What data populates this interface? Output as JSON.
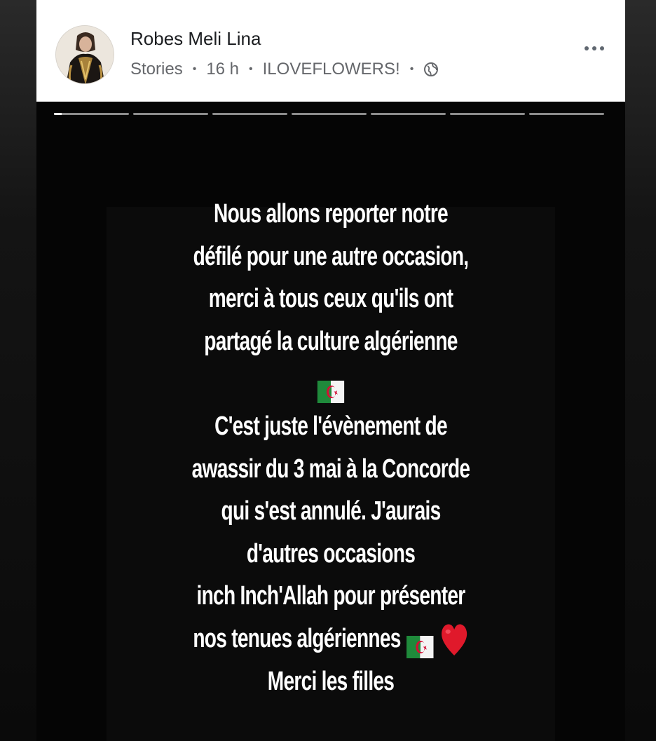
{
  "post": {
    "author_name": "Robes Meli Lina",
    "meta": {
      "type": "Stories",
      "time": "16 h",
      "audience_label": "ILOVEFLOWERS!",
      "privacy_icon": "globe-icon"
    },
    "more_icon": "more-options-icon"
  },
  "story": {
    "progress": {
      "segments": 7,
      "active_index": 0,
      "active_fraction": 0.1
    },
    "lines": [
      "Nous allons reporter notre",
      "défilé pour une autre occasion,",
      "merci à tous ceux qu'ils ont",
      "partagé la culture algérienne",
      "",
      "C'est juste  l'évènement  de",
      "awassir du 3 mai à la Concorde",
      "qui s'est annulé. J'aurais",
      "d'autres occasions",
      "inch Inch'Allah pour présenter",
      "nos tenues algériennes",
      "Merci les filles"
    ],
    "emojis": {
      "flag": "algeria-flag-emoji",
      "heart": "red-heart-emoji"
    }
  },
  "colors": {
    "header_bg": "#ffffff",
    "name_text": "#1c1e21",
    "meta_text": "#65676b",
    "story_bg": "#050505",
    "story_text": "#ffffff",
    "flag_green": "#1f8a3b",
    "flag_red": "#d21034",
    "heart_red": "#e0192b"
  }
}
